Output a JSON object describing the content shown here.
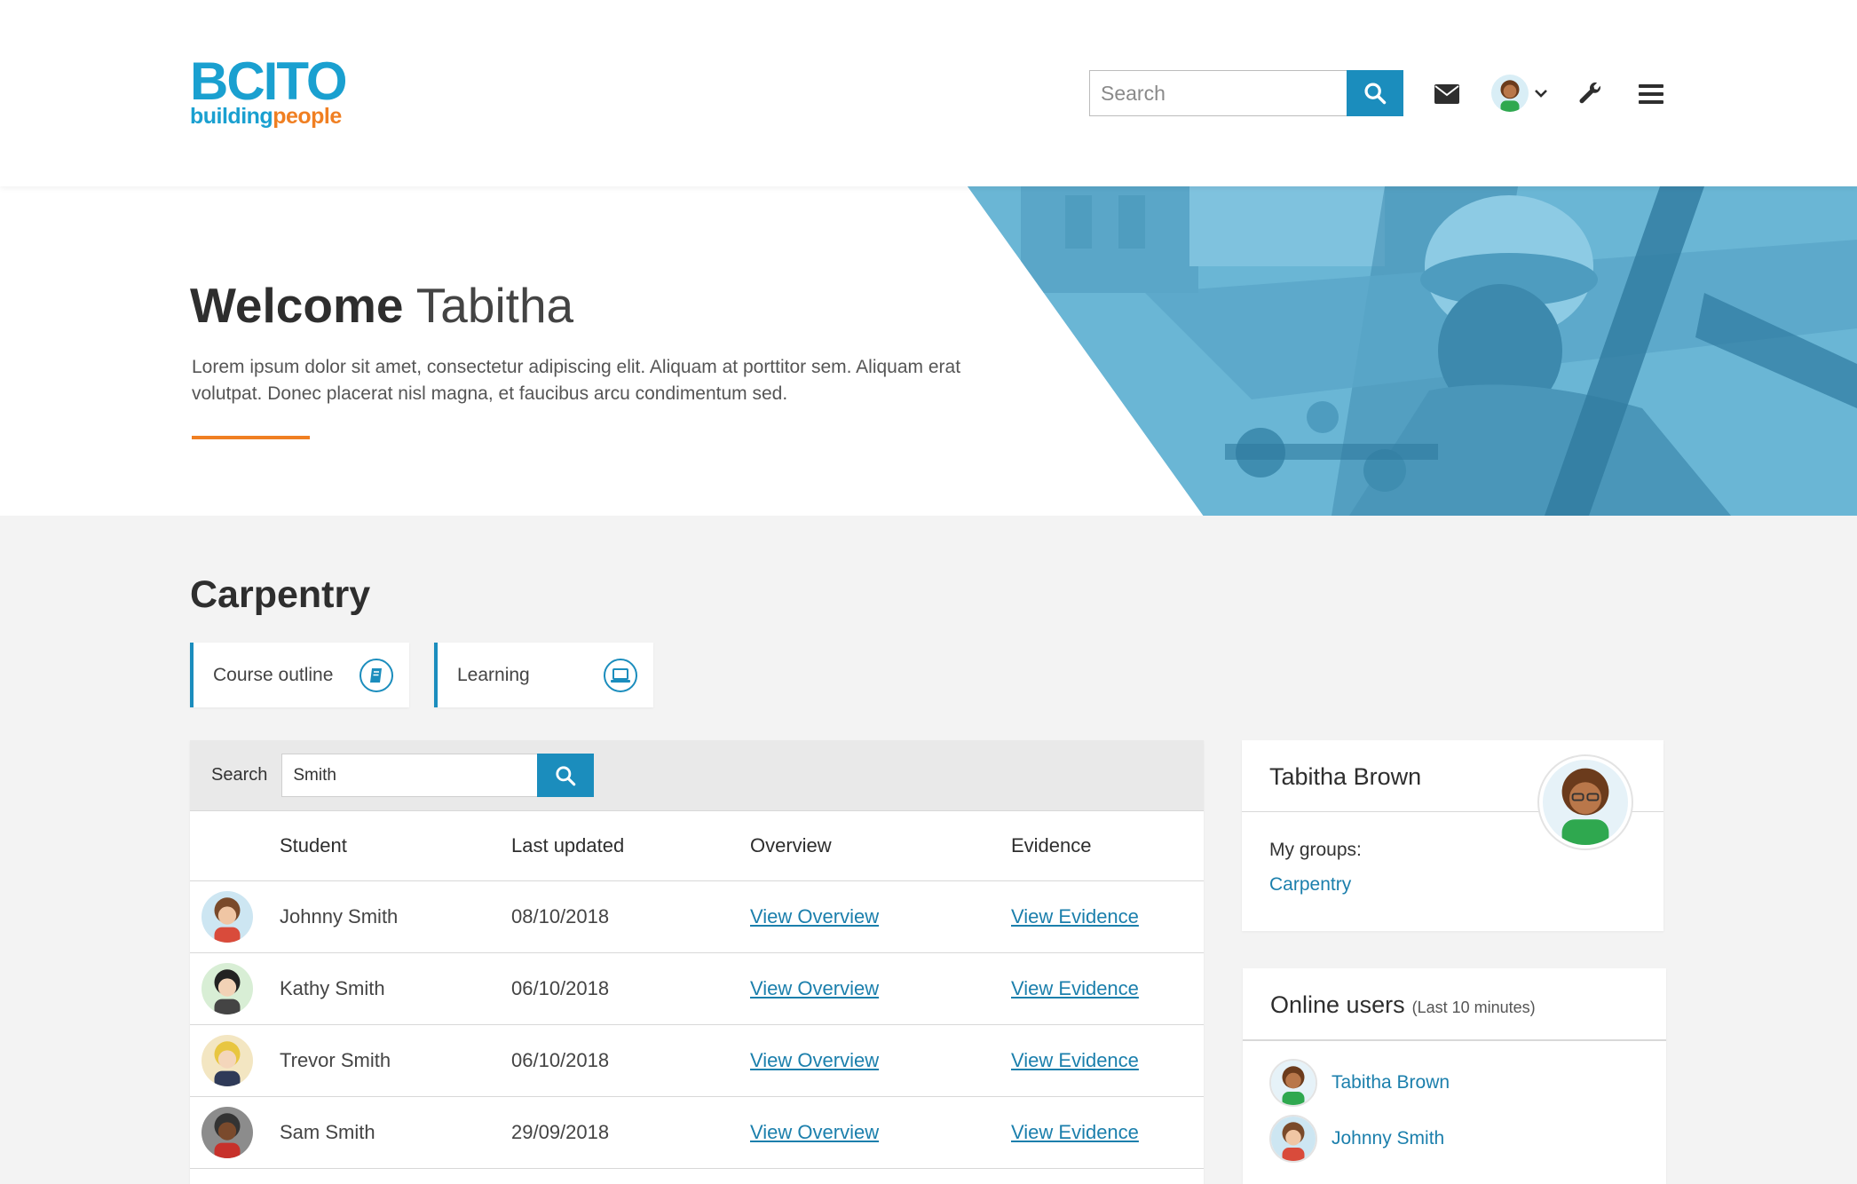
{
  "header": {
    "logo_main": "BCITO",
    "logo_sub_a": "building",
    "logo_sub_b": "people",
    "search_placeholder": "Search",
    "icons": [
      "search-icon",
      "mail-icon",
      "avatar",
      "chevron-down-icon",
      "wrench-icon",
      "menu-icon"
    ]
  },
  "hero": {
    "welcome": "Welcome",
    "name": "Tabitha",
    "paragraph": "Lorem ipsum dolor sit amet, consectetur adipiscing elit. Aliquam at porttitor sem. Aliquam erat volutpat. Donec placerat nisl magna, et faucibus arcu condimentum sed."
  },
  "section": {
    "title": "Carpentry",
    "tiles": [
      {
        "label": "Course outline",
        "icon": "book-icon"
      },
      {
        "label": "Learning",
        "icon": "laptop-icon"
      }
    ]
  },
  "table": {
    "search_label": "Search",
    "search_value": "Smith",
    "columns": [
      "Student",
      "Last updated",
      "Overview",
      "Evidence"
    ],
    "rows": [
      {
        "student": "Johnny Smith",
        "updated": "08/10/2018",
        "overview": "View Overview",
        "evidence": "View Evidence"
      },
      {
        "student": "Kathy Smith",
        "updated": "06/10/2018",
        "overview": "View Overview",
        "evidence": "View Evidence"
      },
      {
        "student": "Trevor Smith",
        "updated": "06/10/2018",
        "overview": "View Overview",
        "evidence": "View Evidence"
      },
      {
        "student": "Sam Smith",
        "updated": "29/09/2018",
        "overview": "View Overview",
        "evidence": "View Evidence"
      }
    ]
  },
  "profile": {
    "name": "Tabitha Brown",
    "groups_label": "My groups:",
    "groups": [
      "Carpentry"
    ]
  },
  "online": {
    "title": "Online users",
    "subtitle": "(Last 10 minutes)",
    "users": [
      "Tabitha Brown",
      "Johnny Smith"
    ]
  },
  "colors": {
    "accent": "#1b8dbd",
    "link": "#1b7fac",
    "brand_orange": "#f07f22",
    "hero_tint": "#6bb7d6"
  }
}
